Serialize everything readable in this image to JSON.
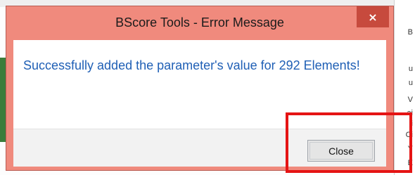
{
  "background": {
    "right_fragments": [
      "B",
      "u",
      "u",
      "V",
      "ai",
      "i",
      "Ci",
      "Y",
      "E"
    ]
  },
  "dialog": {
    "title": "BScore Tools - Error Message",
    "close_glyph": "×",
    "message": "Successfully added the parameter's value for 292 Elements!",
    "button_label": "Close"
  },
  "colors": {
    "frame": "#f08a7d",
    "close_x": "#c74a3d",
    "message_text": "#1f5fb5",
    "annotation": "#e51414"
  }
}
